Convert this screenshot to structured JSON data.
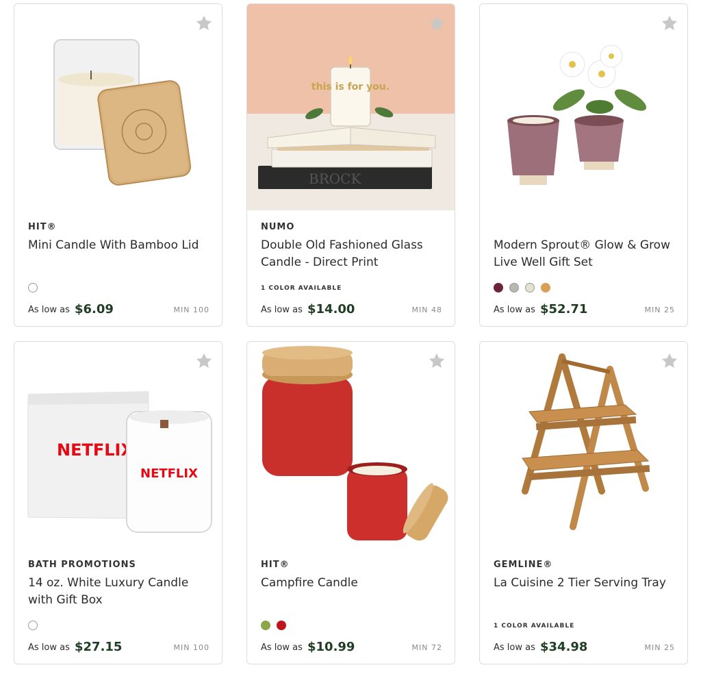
{
  "products": [
    {
      "brand": "HIT®",
      "title": "Mini Candle With Bamboo Lid",
      "colors_note": "",
      "swatches": [
        "#ffffff"
      ],
      "as_low_as": "As low as",
      "price": "$6.09",
      "min": "MIN 100",
      "image": "bamboo-lid-candle"
    },
    {
      "brand": "NUMO",
      "title": "Double Old Fashioned Glass Candle - Direct Print",
      "colors_note": "1 COLOR AVAILABLE",
      "swatches": [],
      "as_low_as": "As low as",
      "price": "$14.00",
      "min": "MIN 48",
      "image": "glass-candle-on-books",
      "image_text": "this is for you.",
      "book_text": "BROCK"
    },
    {
      "brand": "",
      "title": "Modern Sprout® Glow & Grow Live Well Gift Set",
      "colors_note": "",
      "swatches": [
        "#6b2438",
        "#b8b8ae",
        "#e6e2d2",
        "#d9a055"
      ],
      "as_low_as": "As low as",
      "price": "$52.71",
      "min": "MIN 25",
      "image": "planter-gift-set"
    },
    {
      "brand": "BATH PROMOTIONS",
      "title": "14 oz. White Luxury Candle with Gift Box",
      "colors_note": "",
      "swatches": [
        "#ffffff"
      ],
      "as_low_as": "As low as",
      "price": "$27.15",
      "min": "MIN 100",
      "image": "white-candle-gift-box",
      "logo_text": "NETFLIX"
    },
    {
      "brand": "HIT®",
      "title": "Campfire Candle",
      "colors_note": "",
      "swatches": [
        "#8aa84a",
        "#c0141c"
      ],
      "as_low_as": "As low as",
      "price": "$10.99",
      "min": "MIN 72",
      "image": "red-campfire-candle"
    },
    {
      "brand": "GEMLINE®",
      "title": "La Cuisine 2 Tier Serving Tray",
      "colors_note": "1 COLOR AVAILABLE",
      "swatches": [],
      "as_low_as": "As low as",
      "price": "$34.98",
      "min": "MIN 25",
      "image": "two-tier-wood-tray"
    }
  ],
  "colors": {
    "price": "#1f3d22",
    "star": "#c8c8c8",
    "card_border": "#dcdcdc"
  },
  "icons": {
    "favorite": "star-icon"
  }
}
